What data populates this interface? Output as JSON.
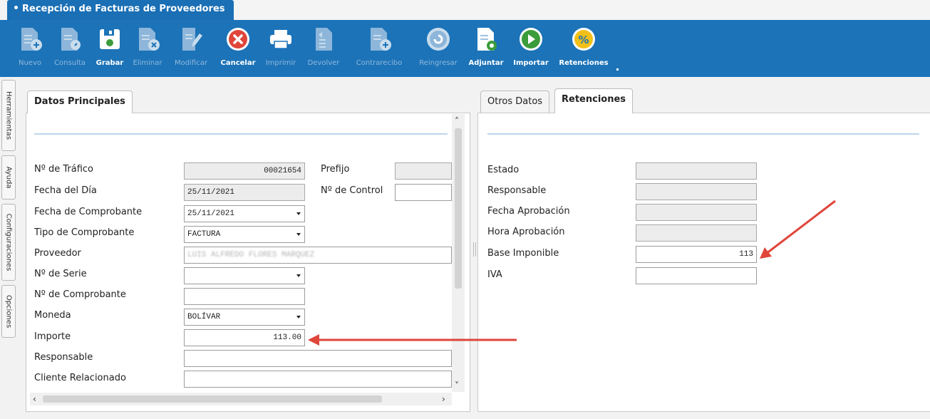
{
  "window": {
    "title": "Recepción de Facturas de Proveedores"
  },
  "toolbar": {
    "buttons": [
      {
        "label": "Nuevo",
        "icon": "doc-add-icon",
        "enabled": false
      },
      {
        "label": "Consulta",
        "icon": "doc-query-icon",
        "enabled": false
      },
      {
        "label": "Grabar",
        "icon": "save-icon",
        "enabled": true
      },
      {
        "label": "Eliminar",
        "icon": "doc-delete-icon",
        "enabled": false
      },
      {
        "label": "Modificar",
        "icon": "edit-icon",
        "enabled": false
      },
      {
        "label": "Cancelar",
        "icon": "cancel-icon",
        "enabled": true
      },
      {
        "label": "Imprimir",
        "icon": "print-icon",
        "enabled": false
      },
      {
        "label": "Devolver",
        "icon": "return-icon",
        "enabled": false
      },
      {
        "label": "Contrarecibo",
        "icon": "receipt-icon",
        "enabled": false
      },
      {
        "label": "Reingresar",
        "icon": "reenter-icon",
        "enabled": false
      },
      {
        "label": "Adjuntar",
        "icon": "attach-icon",
        "enabled": true
      },
      {
        "label": "Importar",
        "icon": "import-icon",
        "enabled": true
      },
      {
        "label": "Retenciones",
        "icon": "percent-icon",
        "enabled": true
      }
    ]
  },
  "side_tabs": [
    "Herramientas",
    "Ayuda",
    "Configuraciones",
    "Opciones"
  ],
  "left_panel": {
    "tab": "Datos Principales",
    "fields": {
      "trafico": {
        "label": "Nº de Tráfico",
        "value": "00021654"
      },
      "prefijo": {
        "label": "Prefijo",
        "value": ""
      },
      "fecha_dia": {
        "label": "Fecha del Día",
        "value": "25/11/2021"
      },
      "control": {
        "label": "Nº de Control",
        "value": ""
      },
      "fecha_comprobante": {
        "label": "Fecha de Comprobante",
        "value": "25/11/2021"
      },
      "tipo_comprobante": {
        "label": "Tipo de Comprobante",
        "value": "FACTURA"
      },
      "proveedor": {
        "label": "Proveedor",
        "value": "LUIS ALFREDO FLORES MARQUEZ"
      },
      "serie": {
        "label": "Nº de Serie",
        "value": ""
      },
      "comprobante": {
        "label": "Nº de Comprobante",
        "value": ""
      },
      "moneda": {
        "label": "Moneda",
        "value": "BOLÍVAR"
      },
      "importe": {
        "label": "Importe",
        "value": "113.00"
      },
      "responsable": {
        "label": "Responsable",
        "value": ""
      },
      "cliente": {
        "label": "Cliente Relacionado",
        "value": ""
      }
    }
  },
  "right_panel": {
    "tabs": [
      "Otros Datos",
      "Retenciones"
    ],
    "active_tab": "Retenciones",
    "fields": {
      "estado": {
        "label": "Estado",
        "value": ""
      },
      "responsable": {
        "label": "Responsable",
        "value": ""
      },
      "fecha_aprobacion": {
        "label": "Fecha Aprobación",
        "value": ""
      },
      "hora_aprobacion": {
        "label": "Hora Aprobación",
        "value": ""
      },
      "base_imponible": {
        "label": "Base Imponible",
        "value": "113"
      },
      "iva": {
        "label": "IVA",
        "value": ""
      }
    }
  },
  "colors": {
    "toolbar": "#1c73b8",
    "annotation_arrow": "#e0453a",
    "separator": "#bcd5ea"
  }
}
